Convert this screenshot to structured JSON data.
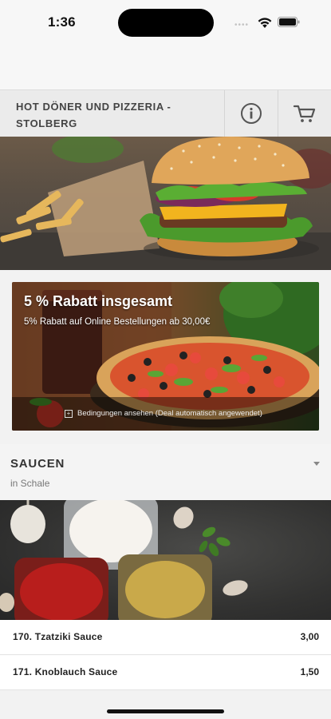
{
  "status": {
    "time": "1:36"
  },
  "header": {
    "restaurant_name": "HOT DÖNER UND PIZZERIA - STOLBERG",
    "info_icon": "info-icon",
    "cart_icon": "cart-icon"
  },
  "deal": {
    "title": "5 % Rabatt insgesamt",
    "subtitle": "5% Rabatt auf Online Bestellungen ab 30,00€",
    "terms": "Bedingungen ansehen (Deal automatisch angewendet)"
  },
  "category": {
    "title": "SAUCEN",
    "subtitle": "in Schale"
  },
  "items": [
    {
      "name": "170. Tzatziki Sauce",
      "price": "3,00"
    },
    {
      "name": "171. Knoblauch Sauce",
      "price": "1,50"
    }
  ],
  "colors": {
    "header_bg": "#ebebeb",
    "text": "#222222",
    "muted": "#777777"
  }
}
